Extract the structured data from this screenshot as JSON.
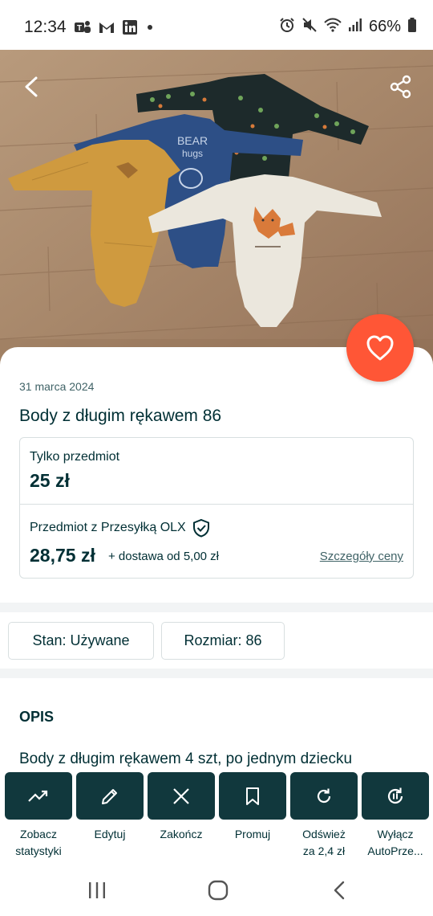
{
  "status_bar": {
    "time": "12:34",
    "battery": "66%",
    "left_icons": [
      "teams-icon",
      "gmail-icon",
      "linkedin-icon",
      "dot-icon"
    ],
    "right_icons": [
      "alarm-icon",
      "mute-icon",
      "wifi-icon",
      "signal-icon",
      "battery-icon"
    ]
  },
  "photo": {
    "back_icon": "back-arrow-icon",
    "share_icon": "share-icon",
    "shirt_texts": [
      "BEAR",
      "hugs"
    ]
  },
  "favorite_icon": "heart-icon",
  "listing": {
    "date": "31 marca 2024",
    "title": "Body z długim rękawem 86"
  },
  "price": {
    "only_item_label": "Tylko przedmiot",
    "only_item_price": "25 zł",
    "with_shipping_label": "Przedmiot z Przesyłką OLX",
    "with_shipping_price": "28,75 zł",
    "delivery_text": "+ dostawa od 5,00 zł",
    "details_link": "Szczegóły ceny"
  },
  "chips": [
    "Stan: Używane",
    "Rozmiar: 86"
  ],
  "description": {
    "heading": "OPIS",
    "text": "Body z długim rękawem 4 szt, po jednym dziecku"
  },
  "actions": [
    {
      "label_line1": "Zobacz",
      "label_line2": "statystyki",
      "icon": "trending-up-icon"
    },
    {
      "label_line1": "Edytuj",
      "label_line2": "",
      "icon": "pencil-icon"
    },
    {
      "label_line1": "Zakończ",
      "label_line2": "",
      "icon": "close-icon"
    },
    {
      "label_line1": "Promuj",
      "label_line2": "",
      "icon": "bookmark-icon"
    },
    {
      "label_line1": "Odśwież",
      "label_line2": "za 2,4 zł",
      "icon": "refresh-icon"
    },
    {
      "label_line1": "Wyłącz",
      "label_line2": "AutoPrze...",
      "icon": "autorenew-pause-icon"
    }
  ],
  "colors": {
    "accent_orange": "#ff5636",
    "dark_teal": "#11383d",
    "text_primary": "#002f34"
  }
}
